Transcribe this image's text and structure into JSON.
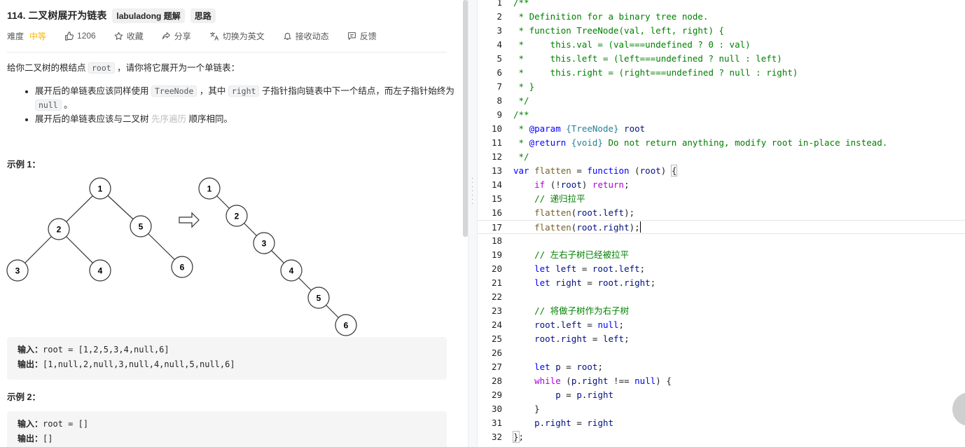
{
  "problem": {
    "title": "114. 二叉树展开为链表",
    "tags": [
      "labuladong 题解",
      "思路"
    ],
    "meta": {
      "difficulty_label": "难度",
      "difficulty": "中等",
      "likes": "1206",
      "collect": "收藏",
      "share": "分享",
      "switch_lang": "切换为英文",
      "notify": "接收动态",
      "feedback": "反馈"
    },
    "desc": {
      "p1_a": "给你二叉树的根结点 ",
      "p1_code": "root",
      "p1_b": " ，请你将它展开为一个单链表：",
      "b1_a": "展开后的单链表应该同样使用 ",
      "b1_code1": "TreeNode",
      "b1_b": " ，其中 ",
      "b1_code2": "right",
      "b1_c": " 子指针指向链表中下一个结点，而左子指针始终为 ",
      "b1_code3": "null",
      "b1_d": " 。",
      "b2_a": "展开后的单链表应该与二叉树 ",
      "b2_link": "先序遍历",
      "b2_b": " 顺序相同。"
    },
    "example1": {
      "title": "示例 1：",
      "input_label": "输入：",
      "input": "root = [1,2,5,3,4,null,6]",
      "output_label": "输出：",
      "output": "[1,null,2,null,3,null,4,null,5,null,6]"
    },
    "example2": {
      "title": "示例 2：",
      "input_label": "输入：",
      "input": "root = []",
      "output_label": "输出：",
      "output": "[]"
    },
    "tree_labels": [
      "1",
      "2",
      "5",
      "3",
      "4",
      "6",
      "1",
      "2",
      "3",
      "4",
      "5",
      "6"
    ]
  },
  "editor": {
    "line_numbers": [
      "1",
      "2",
      "3",
      "4",
      "5",
      "6",
      "7",
      "8",
      "9",
      "10",
      "11",
      "12",
      "13",
      "14",
      "15",
      "16",
      "17",
      "18",
      "19",
      "20",
      "21",
      "22",
      "23",
      "24",
      "25",
      "26",
      "27",
      "28",
      "29",
      "30",
      "31",
      "32"
    ],
    "current_line": "17",
    "tokens": {
      "l1": "/**",
      "l2": " * Definition for a binary tree node.",
      "l3": " * function TreeNode(val, left, right) {",
      "l4": " *     this.val = (val===undefined ? 0 : val)",
      "l5": " *     this.left = (left===undefined ? null : left)",
      "l6": " *     this.right = (right===undefined ? null : right)",
      "l7": " * }",
      "l8": " */",
      "l9": "/**",
      "l10_a": " * ",
      "l10_tag": "@param",
      "l10_sp": " ",
      "l10_type": "{TreeNode}",
      "l10_name": " root",
      "l11_a": " * ",
      "l11_tag": "@return",
      "l11_sp": " ",
      "l11_type": "{void}",
      "l11_rest": " Do not return anything, modify root in-place instead.",
      "l12": " */",
      "var": "var",
      "flatten": "flatten",
      "eq": " = ",
      "function": "function",
      "root": "root",
      "if": "if",
      "return": "return",
      "left": "left",
      "right": "right",
      "let": "let",
      "null": "null",
      "while": "while",
      "p": "p",
      "c15": "// 递归拉平",
      "c19": "// 左右子树已经被拉平",
      "c23": "// 将做子树作为右子树"
    }
  },
  "colors": {
    "comment": "#008000",
    "keyword": "#0000ff",
    "control": "#af00db",
    "function": "#795e26",
    "variable": "#001080",
    "type": "#267f99",
    "difficulty": "#ffb800"
  }
}
